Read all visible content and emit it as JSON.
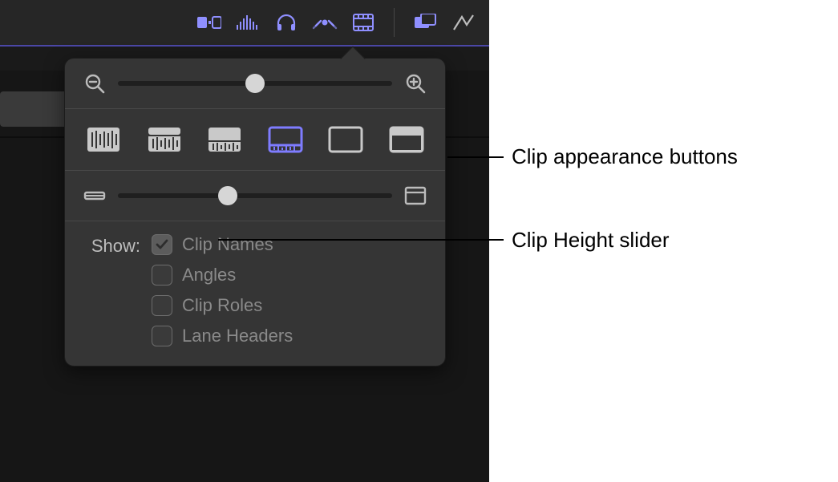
{
  "toolbar": {
    "icons": [
      {
        "name": "timeline-index-icon"
      },
      {
        "name": "audio-meters-icon"
      },
      {
        "name": "headphones-icon"
      },
      {
        "name": "skimming-icon"
      },
      {
        "name": "clip-appearance-icon"
      },
      {
        "name": "split-view-icon"
      },
      {
        "name": "timeline-sync-icon"
      }
    ]
  },
  "zoom": {
    "value_percent": 50
  },
  "appearance_buttons": {
    "selected_index": 3
  },
  "clip_height": {
    "value_percent": 40
  },
  "show": {
    "label": "Show:",
    "items": [
      {
        "label": "Clip Names",
        "checked": true
      },
      {
        "label": "Angles",
        "checked": false
      },
      {
        "label": "Clip Roles",
        "checked": false
      },
      {
        "label": "Lane Headers",
        "checked": false
      }
    ]
  },
  "callouts": {
    "appearance": "Clip appearance buttons",
    "height": "Clip Height slider"
  }
}
